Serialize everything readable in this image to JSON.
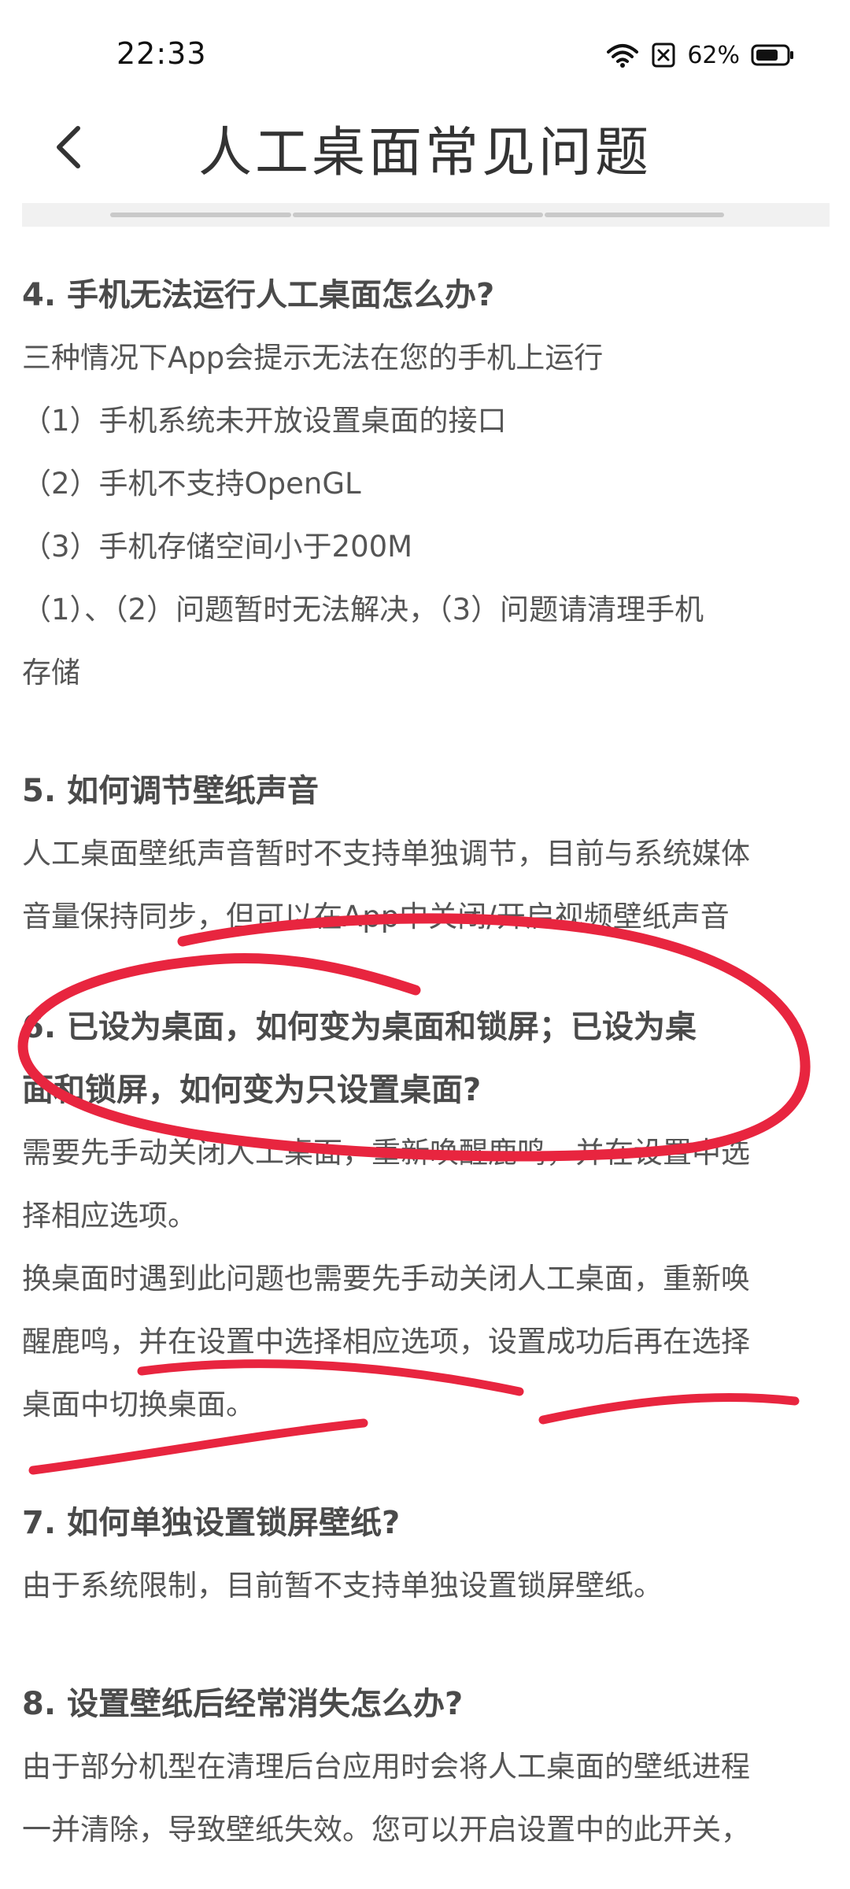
{
  "status_bar": {
    "time": "22:33",
    "battery": "62%",
    "icons": [
      "wifi-icon",
      "sim-off-icon",
      "battery-icon"
    ]
  },
  "header": {
    "title": "人工桌面常见问题",
    "back_icon": "chevron-left-icon"
  },
  "faq": [
    {
      "question": "4. 手机无法运行人工桌面怎么办?",
      "lines": [
        "三种情况下App会提示无法在您的手机上运行",
        "（1）手机系统未开放设置桌面的接口",
        "（2）手机不支持OpenGL",
        "（3）手机存储空间小于200M",
        "（1）、（2）问题暂时无法解决，（3）问题请清理手机",
        "存储"
      ]
    },
    {
      "question": "5. 如何调节壁纸声音",
      "lines": [
        "人工桌面壁纸声音暂时不支持单独调节，目前与系统媒体",
        "音量保持同步，但可以在App中关闭/开启视频壁纸声音"
      ]
    },
    {
      "question_lines": [
        "6. 已设为桌面，如何变为桌面和锁屏；已设为桌",
        "面和锁屏，如何变为只设置桌面?"
      ],
      "lines": [
        "需要先手动关闭人工桌面，重新唤醒鹿鸣，并在设置中选",
        "择相应选项。",
        "换桌面时遇到此问题也需要先手动关闭人工桌面，重新唤",
        "醒鹿鸣，并在设置中选择相应选项，设置成功后再在选择",
        "桌面中切换桌面。"
      ]
    },
    {
      "question": "7. 如何单独设置锁屏壁纸?",
      "lines": [
        "由于系统限制，目前暂不支持单独设置锁屏壁纸。"
      ]
    },
    {
      "question": "8. 设置壁纸后经常消失怎么办?",
      "lines": [
        "由于部分机型在清理后台应用时会将人工桌面的壁纸进程",
        "一并清除，导致壁纸失效。您可以开启设置中的此开关，"
      ]
    }
  ],
  "annotation_color": "#e8253f"
}
